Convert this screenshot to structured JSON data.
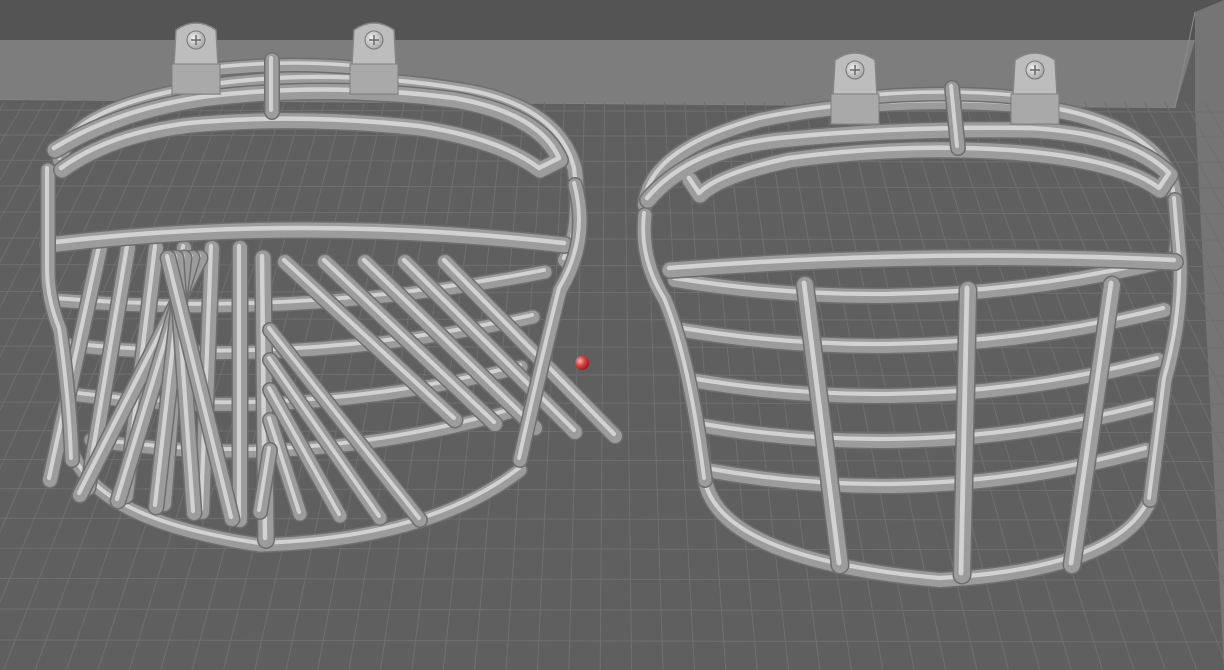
{
  "viewport": {
    "colors": {
      "floor": "#5f5f5f",
      "grid": "#6f6f6f",
      "wall": "#7c7c7c",
      "wall_top": "#545454",
      "model_fill": "#9c9c9c",
      "model_light": "#dcdcdc",
      "model_edge": "#6e6e6e",
      "bracket": "#bdbdbd",
      "pivot_marker": "#d9423f"
    }
  },
  "objects": [
    {
      "id": "facemask-diagonal",
      "icon": "facemask-icon"
    },
    {
      "id": "facemask-vertical",
      "icon": "facemask-icon"
    }
  ],
  "pivot": {
    "icon": "pivot-point-icon"
  }
}
